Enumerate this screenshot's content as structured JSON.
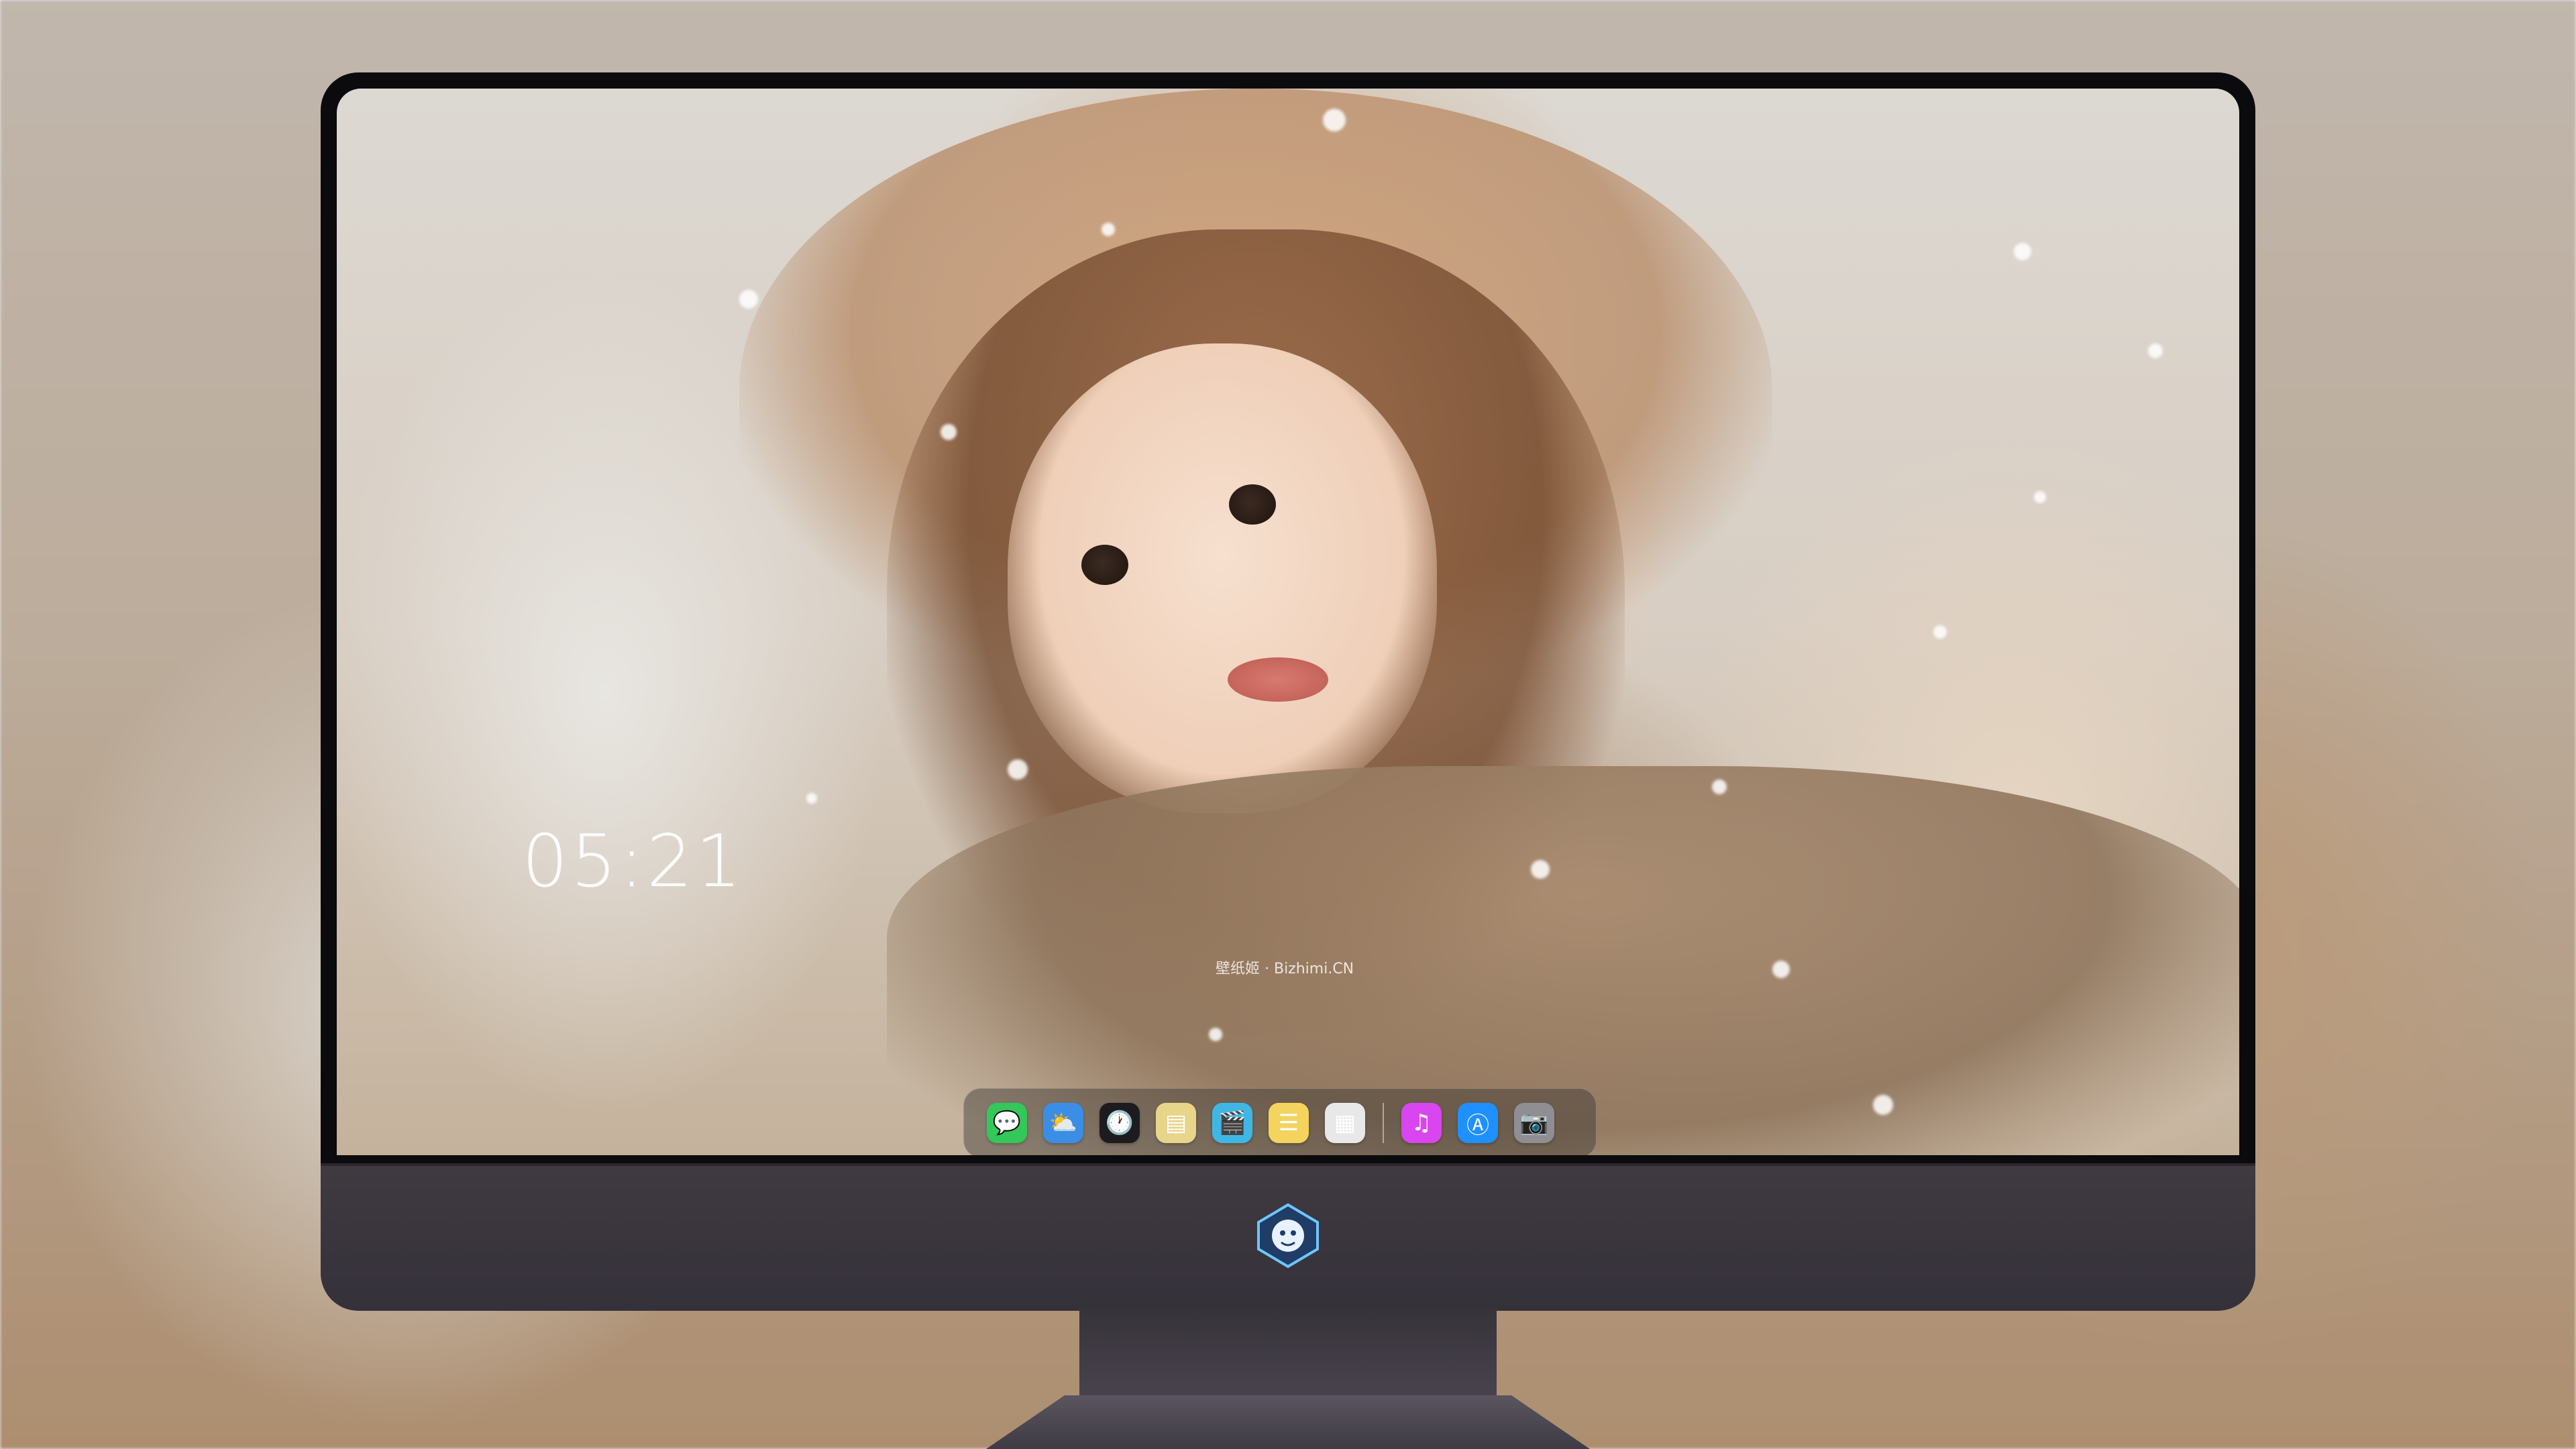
{
  "desktop": {
    "clock": "05:21",
    "watermark": "壁纸姬 · Bizhimi.CN"
  },
  "dock": {
    "apps": [
      {
        "name": "Messages",
        "icon": "messages-icon",
        "glyph": "💬",
        "color": "#34c759"
      },
      {
        "name": "Weather",
        "icon": "weather-icon",
        "glyph": "⛅",
        "color": "#3a8ee6"
      },
      {
        "name": "Clock",
        "icon": "clock-icon",
        "glyph": "🕐",
        "color": "#1c1c1e"
      },
      {
        "name": "Preview",
        "icon": "preview-icon",
        "glyph": "▤",
        "color": "#e7d58a"
      },
      {
        "name": "Clips",
        "icon": "clips-icon",
        "glyph": "🎬",
        "color": "#3fb7e6"
      },
      {
        "name": "Notes",
        "icon": "notes-icon",
        "glyph": "☰",
        "color": "#f4d35e"
      },
      {
        "name": "Photos",
        "icon": "photos-icon",
        "glyph": "▦",
        "color": "#e8e8e8"
      }
    ],
    "apps_after_separator": [
      {
        "name": "iTunes",
        "icon": "music-icon",
        "glyph": "♫",
        "color": "#d946ef"
      },
      {
        "name": "App Store",
        "icon": "app-store-icon",
        "glyph": "Ⓐ",
        "color": "#1e90ff"
      },
      {
        "name": "Camera",
        "icon": "camera-icon",
        "glyph": "📷",
        "color": "#8e8e93"
      }
    ]
  },
  "colors": {
    "bezel": "#0b0b0d",
    "chin": "#3f3a40",
    "dock_bg": "rgba(60,55,52,0.45)"
  }
}
